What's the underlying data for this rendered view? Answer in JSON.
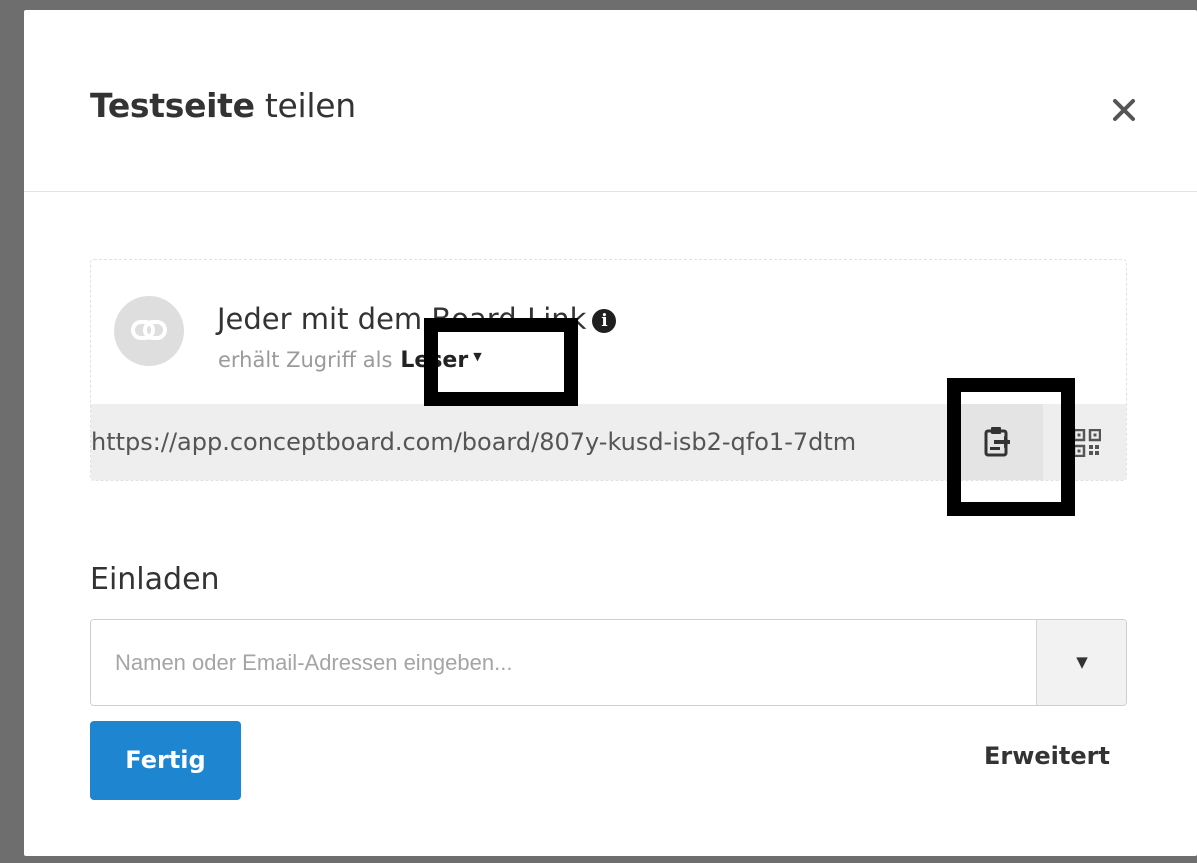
{
  "dialog": {
    "title_bold": "Testseite",
    "title_rest": " teilen",
    "close_label": "×"
  },
  "link_access": {
    "title": "Jeder mit dem Board-Link",
    "subtitle_prefix": "erhält Zugriff als",
    "role": "Leser",
    "icon": "link-icon",
    "info_icon": "i",
    "url": "https://app.conceptboard.com/board/807y-kusd-isb2-qfo1-7dtm",
    "copy_icon": "clipboard-copy-icon",
    "qr_icon": "qr-code-icon"
  },
  "invite": {
    "label": "Einladen",
    "placeholder": "Namen oder Email-Adressen eingeben...",
    "dropdown_icon": "▼"
  },
  "footer": {
    "done_label": "Fertig",
    "advanced_label": "Erweitert"
  },
  "colors": {
    "primary": "#1e86d0",
    "backdrop": "#6e6e6e",
    "highlight": "#000000"
  }
}
